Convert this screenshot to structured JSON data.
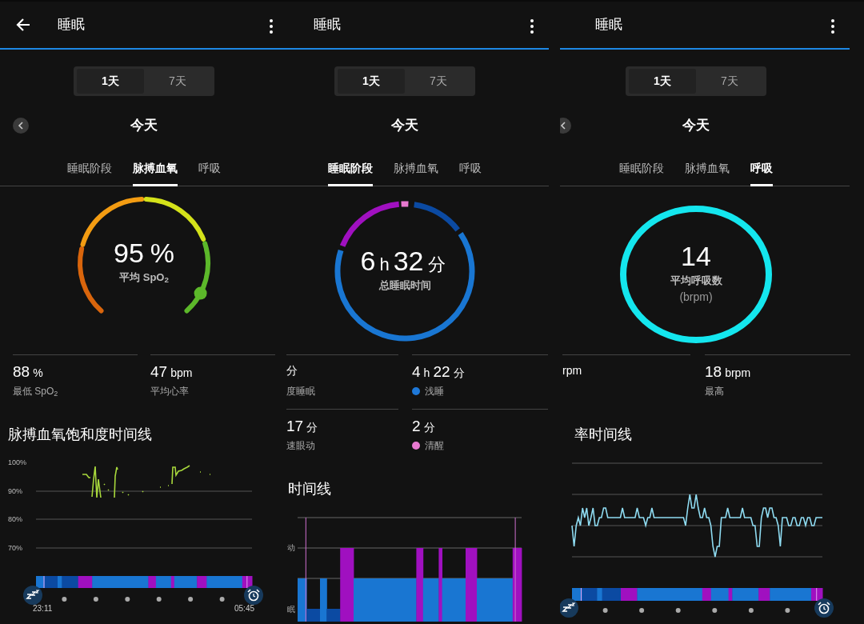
{
  "panels": [
    {
      "header": {
        "back": true,
        "title": "睡眠",
        "menu": true
      },
      "range_tabs": [
        {
          "label": "1天",
          "selected": true
        },
        {
          "label": "7天",
          "selected": false
        }
      ],
      "date": {
        "prev": true,
        "label": "今天"
      },
      "metric_tabs": [
        {
          "label": "睡眠阶段",
          "selected": false
        },
        {
          "label": "脉搏血氧",
          "selected": true
        },
        {
          "label": "呼吸",
          "selected": false
        }
      ],
      "summary": {
        "kind": "spo2",
        "parts": [
          {
            "num": "95",
            "unit": "%"
          }
        ],
        "label": "平均 SpO$_{2}$"
      },
      "stats": [
        {
          "parts": [
            {
              "num": "88",
              "unit": "%"
            }
          ],
          "label": "最低 SpO$_{2}$"
        },
        {
          "parts": [
            {
              "num": "47",
              "unit": "bpm"
            }
          ],
          "label": "平均心率"
        }
      ],
      "chart": {
        "title": "脉搏血氧饱和度时间线",
        "kind": "spo2",
        "y_labels": [
          "100%",
          "90%",
          "80%",
          "70%"
        ],
        "start": "23:11",
        "end": "05:45"
      }
    },
    {
      "header": {
        "back": false,
        "title": "睡眠",
        "menu": true
      },
      "range_tabs": [
        {
          "label": "1天",
          "selected": true
        },
        {
          "label": "7天",
          "selected": false
        }
      ],
      "date": {
        "prev": false,
        "label": "今天"
      },
      "metric_tabs": [
        {
          "label": "睡眠阶段",
          "selected": true
        },
        {
          "label": "脉搏血氧",
          "selected": false
        },
        {
          "label": "呼吸",
          "selected": false
        }
      ],
      "summary": {
        "kind": "sleep",
        "parts": [
          {
            "num": "6",
            "unit": "h"
          },
          {
            "num": "32",
            "unit": "分"
          }
        ],
        "label": "总睡眠时间"
      },
      "stats": [
        {
          "parts": [
            {
              "unit": "分"
            }
          ],
          "label": "度睡眠"
        },
        {
          "parts": [
            {
              "num": "4",
              "unit": "h"
            },
            {
              "num": "22",
              "unit": "分"
            }
          ],
          "label": "浅睡",
          "color": "#1e78d8"
        },
        {
          "parts": [
            {
              "num": "17",
              "unit": "分"
            }
          ],
          "label": "速眼动"
        },
        {
          "parts": [
            {
              "num": "2",
              "unit": "分"
            }
          ],
          "label": "清醒",
          "color": "#e879d0"
        }
      ],
      "chart": {
        "title": "时间线",
        "kind": "stages",
        "y_labels": [
          "动",
          "眠"
        ]
      }
    },
    {
      "header": {
        "back": false,
        "title": "睡眠",
        "menu": true
      },
      "range_tabs": [
        {
          "label": "1天",
          "selected": true
        },
        {
          "label": "7天",
          "selected": false
        }
      ],
      "date": {
        "prev": true,
        "label": "今天"
      },
      "metric_tabs": [
        {
          "label": "睡眠阶段",
          "selected": false
        },
        {
          "label": "脉搏血氧",
          "selected": false
        },
        {
          "label": "呼吸",
          "selected": true
        }
      ],
      "summary": {
        "kind": "respiration",
        "parts": [
          {
            "num": "14"
          }
        ],
        "label": "平均呼吸数",
        "sublabel": "(brpm)"
      },
      "stats": [
        {
          "parts": [
            {
              "unit": "rpm"
            }
          ]
        },
        {
          "parts": [
            {
              "num": "18",
              "unit": "brpm"
            }
          ],
          "label": "最高"
        }
      ],
      "chart": {
        "title": "率时间线",
        "kind": "respiration"
      }
    }
  ]
}
